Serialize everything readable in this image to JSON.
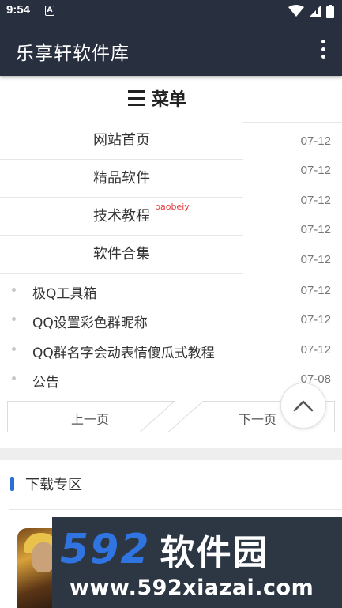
{
  "status_bar": {
    "time": "9:54",
    "notification_letter": "A",
    "icons": [
      "wifi-icon",
      "signal-icon",
      "battery-icon"
    ]
  },
  "app_bar": {
    "title": "乐享轩软件库",
    "menu_icon": "more-vertical-icon"
  },
  "menu": {
    "title": "菜单",
    "items": [
      {
        "label": "网站首页",
        "badge": ""
      },
      {
        "label": "精品软件",
        "badge": ""
      },
      {
        "label": "技术教程",
        "badge": "baobeiy"
      },
      {
        "label": "软件合集",
        "badge": ""
      }
    ]
  },
  "dates_column": [
    "07-12",
    "07-12",
    "07-12",
    "07-12",
    "07-12"
  ],
  "articles": [
    {
      "title": "极Q工具箱",
      "date": "07-12"
    },
    {
      "title": "QQ设置彩色群昵称",
      "date": "07-12"
    },
    {
      "title": "QQ群名字会动表情傻瓜式教程",
      "date": "07-12"
    },
    {
      "title": "公告",
      "date": "07-08"
    }
  ],
  "pager": {
    "prev_label": "上一页",
    "next_label": "下一页"
  },
  "back_to_top_icon": "chevron-up-icon",
  "download_section": {
    "title": "下载专区",
    "accent_color": "#2a6fd6"
  },
  "watermark": {
    "brand_digits": "592",
    "brand_text": "软件园",
    "url": "www.592xiazai.com"
  },
  "colors": {
    "app_bar": "#283040",
    "badge": "#e5383b",
    "watermark_bg": "#2d3743",
    "watermark_digits": "#2f74e0"
  }
}
